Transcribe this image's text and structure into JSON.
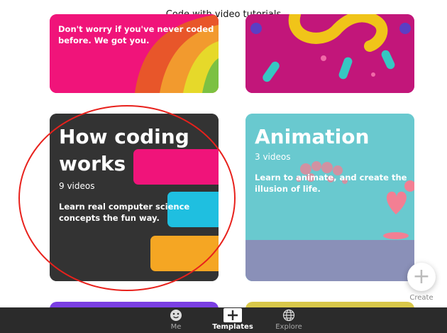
{
  "header": {
    "title": "Code with video tutorials"
  },
  "cards": {
    "top_left": {
      "desc_line1": "Don't worry if you've never coded",
      "desc_line2": "before. We got you."
    },
    "coding": {
      "title_line1": "How coding",
      "title_line2": "works",
      "count": "9 videos",
      "desc_line1": "Learn real computer science",
      "desc_line2": "concepts the fun way."
    },
    "animation": {
      "title": "Animation",
      "count": "3 videos",
      "desc_line1": "Learn to animate, and create the",
      "desc_line2": "illusion of life."
    }
  },
  "create": {
    "label": "Create"
  },
  "tabbar": {
    "tabs": [
      {
        "label": "Me",
        "icon": "face-icon"
      },
      {
        "label": "Templates",
        "icon": "plus-icon",
        "active": true
      },
      {
        "label": "Explore",
        "icon": "globe-icon"
      }
    ]
  },
  "colors": {
    "coding_card": "#333333",
    "animation_card": "#69c9cf",
    "pink": "#f0147a",
    "cyan": "#1fbfe0",
    "orange": "#f5a623",
    "annotation": "#e8211c"
  }
}
